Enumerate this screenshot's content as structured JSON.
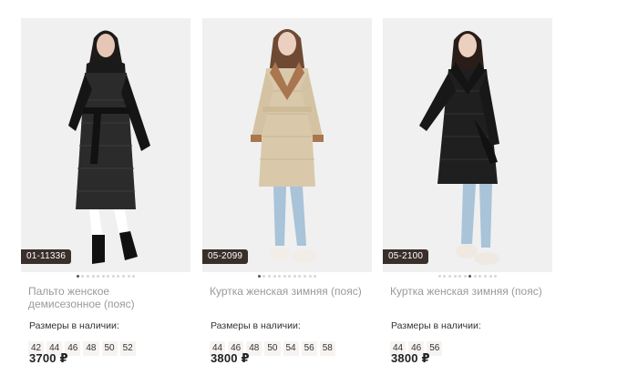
{
  "products": [
    {
      "sku": "01-11336",
      "title": "Пальто женское демисезонное (пояс)",
      "sizes_label": "Размеры в наличии:",
      "sizes": [
        "42",
        "44",
        "46",
        "48",
        "50",
        "52"
      ],
      "price": "3700 ₽",
      "dots": {
        "count": 12,
        "active": 0
      }
    },
    {
      "sku": "05-2099",
      "title": "Куртка женская зимняя (пояс)",
      "sizes_label": "Размеры в наличии:",
      "sizes": [
        "44",
        "46",
        "48",
        "50",
        "54",
        "56",
        "58"
      ],
      "price": "3800 ₽",
      "dots": {
        "count": 12,
        "active": 0
      }
    },
    {
      "sku": "05-2100",
      "title": "Куртка женская зимняя (пояс)",
      "sizes_label": "Размеры в наличии:",
      "sizes": [
        "44",
        "46",
        "56"
      ],
      "price": "3800 ₽",
      "dots": {
        "count": 12,
        "active": 6
      }
    }
  ]
}
